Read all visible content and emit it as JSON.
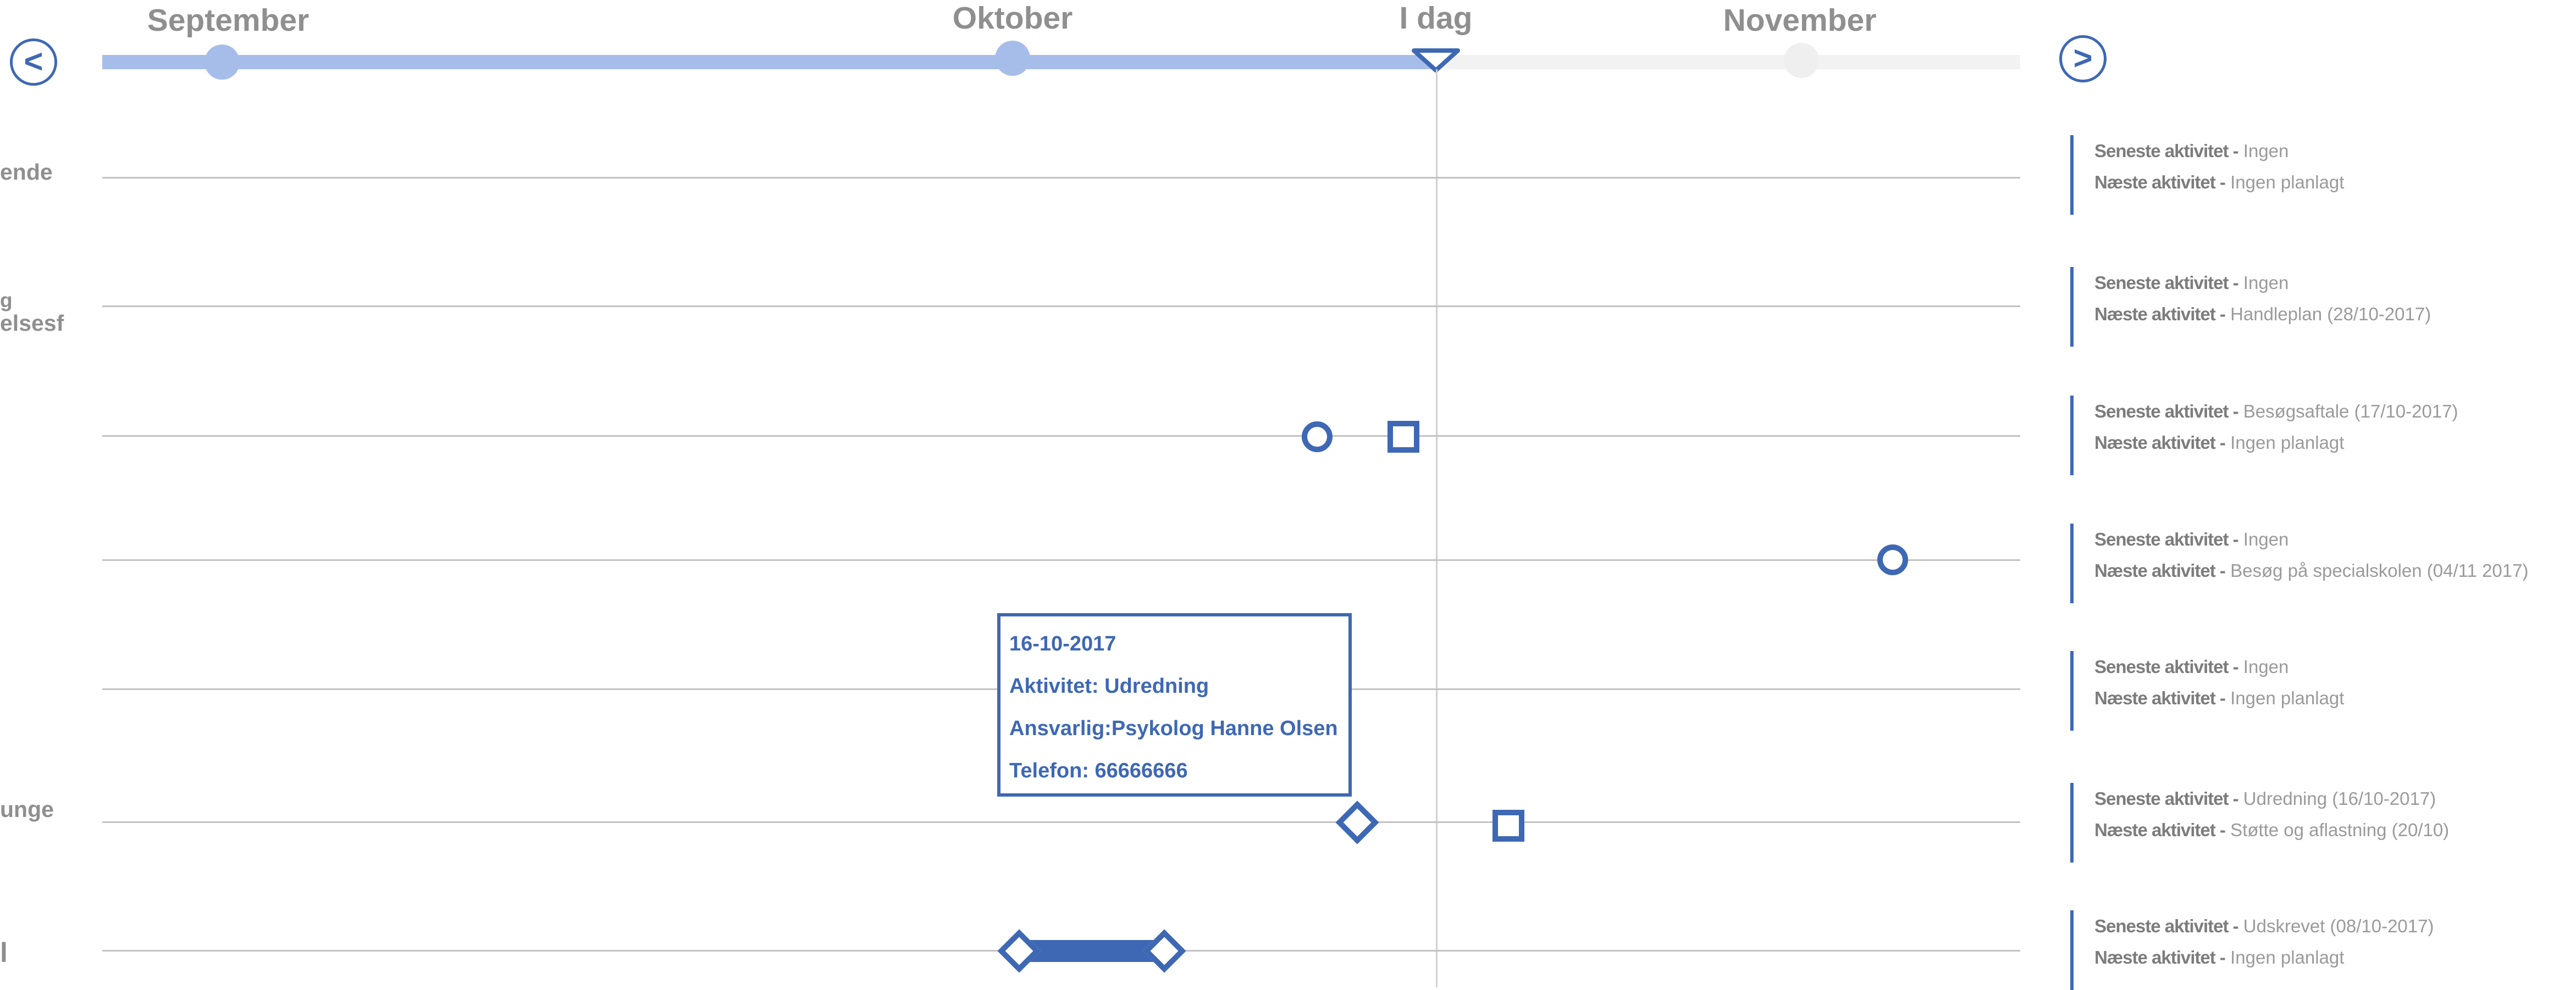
{
  "timeline": {
    "months": [
      {
        "label": "September",
        "state": "past"
      },
      {
        "label": "Oktober",
        "state": "past"
      },
      {
        "label": "I dag",
        "state": "today"
      },
      {
        "label": "November",
        "state": "future"
      }
    ],
    "prev_label": "<",
    "next_label": ">"
  },
  "rows": [
    {
      "label": "ende"
    },
    {
      "label": "g\nelsesf"
    },
    {
      "label": ""
    },
    {
      "label": ""
    },
    {
      "label": ""
    },
    {
      "label": "unge"
    },
    {
      "label": "l"
    }
  ],
  "info_panel": [
    {
      "last_label": "Seneste aktivitet -",
      "last_value": "Ingen",
      "next_label": "Næste aktivitet -",
      "next_value": "Ingen planlagt"
    },
    {
      "last_label": "Seneste aktivitet -",
      "last_value": "Ingen",
      "next_label": "Næste aktivitet -",
      "next_value": "Handleplan (28/10-2017)"
    },
    {
      "last_label": "Seneste aktivitet -",
      "last_value": "Besøgsaftale (17/10-2017)",
      "next_label": "Næste aktivitet -",
      "next_value": "Ingen planlagt"
    },
    {
      "last_label": "Seneste aktivitet -",
      "last_value": "Ingen",
      "next_label": "Næste aktivitet -",
      "next_value": "Besøg på specialskolen (04/11 2017)"
    },
    {
      "last_label": "Seneste aktivitet -",
      "last_value": "Ingen",
      "next_label": "Næste aktivitet -",
      "next_value": "Ingen planlagt"
    },
    {
      "last_label": "Seneste aktivitet -",
      "last_value": "Udredning  (16/10-2017)",
      "next_label": "Næste aktivitet -",
      "next_value": "Støtte og aflastning (20/10)"
    },
    {
      "last_label": "Seneste aktivitet -",
      "last_value": "Udskrevet (08/10-2017)",
      "next_label": "Næste aktivitet -",
      "next_value": "Ingen planlagt"
    }
  ],
  "tooltip": {
    "date": "16-10-2017",
    "activity": "Aktivitet: Udredning",
    "responsible": "Ansvarlig:Psykolog Hanne Olsen",
    "phone": "Telefon: 66666666"
  },
  "colors": {
    "accent": "#3e68b4",
    "track_past": "#a7bde9",
    "track_future": "#f2f2f2",
    "muted_text": "#8f8f8f"
  },
  "icons": {
    "prev": "chevron-left-icon",
    "next": "chevron-right-icon",
    "today": "triangle-down-icon"
  }
}
